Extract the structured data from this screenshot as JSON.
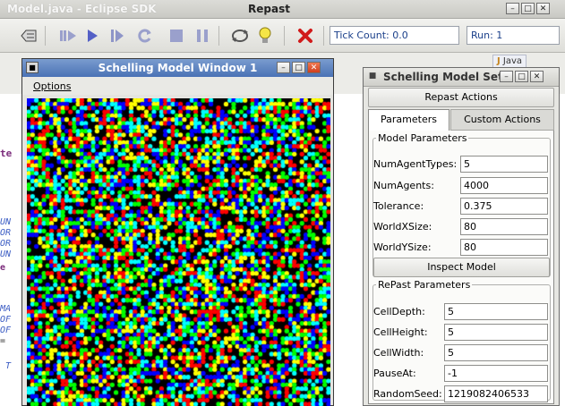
{
  "repast": {
    "ghost_title": "Model.java - Eclipse SDK",
    "title": "Repast",
    "tick_label": "Tick Count: 0.0",
    "run_label": "Run: 1",
    "toolbar_icons": [
      "setup-icon",
      "step-forward-icon",
      "run-icon",
      "step-icon",
      "reload-icon",
      "stop-icon",
      "pause-icon",
      "refresh-icon",
      "lightbulb-icon",
      "close-red-icon"
    ]
  },
  "eclipse": {
    "ghost_codes": [
      "te",
      "UN",
      "OR",
      "OR",
      "UN",
      "e",
      "MA",
      "OF",
      "OF",
      "=",
      "T"
    ],
    "perspective": "Java"
  },
  "model_window": {
    "title": "Schelling Model Window 1",
    "menu_options": "Options",
    "grid": {
      "rows": 80,
      "cols": 80,
      "agent_colors": [
        "#ff0000",
        "#00ff00",
        "#0000ff",
        "#ffff00",
        "#00ffff"
      ],
      "background": "#000000"
    }
  },
  "settings": {
    "title": "Schelling Model Set",
    "repast_actions": "Repast Actions",
    "tabs": {
      "parameters": "Parameters",
      "custom_actions": "Custom Actions"
    },
    "model_parameters_title": "Model Parameters",
    "model_parameters": [
      {
        "label": "NumAgentTypes:",
        "value": "5"
      },
      {
        "label": "NumAgents:",
        "value": "4000"
      },
      {
        "label": "Tolerance:",
        "value": "0.375"
      },
      {
        "label": "WorldXSize:",
        "value": "80"
      },
      {
        "label": "WorldYSize:",
        "value": "80"
      }
    ],
    "inspect_button": "Inspect Model",
    "repast_parameters_title": "RePast Parameters",
    "repast_parameters": [
      {
        "label": "CellDepth:",
        "value": "5"
      },
      {
        "label": "CellHeight:",
        "value": "5"
      },
      {
        "label": "CellWidth:",
        "value": "5"
      },
      {
        "label": "PauseAt:",
        "value": "-1"
      },
      {
        "label": "RandomSeed:",
        "value": "1219082406533"
      }
    ]
  }
}
